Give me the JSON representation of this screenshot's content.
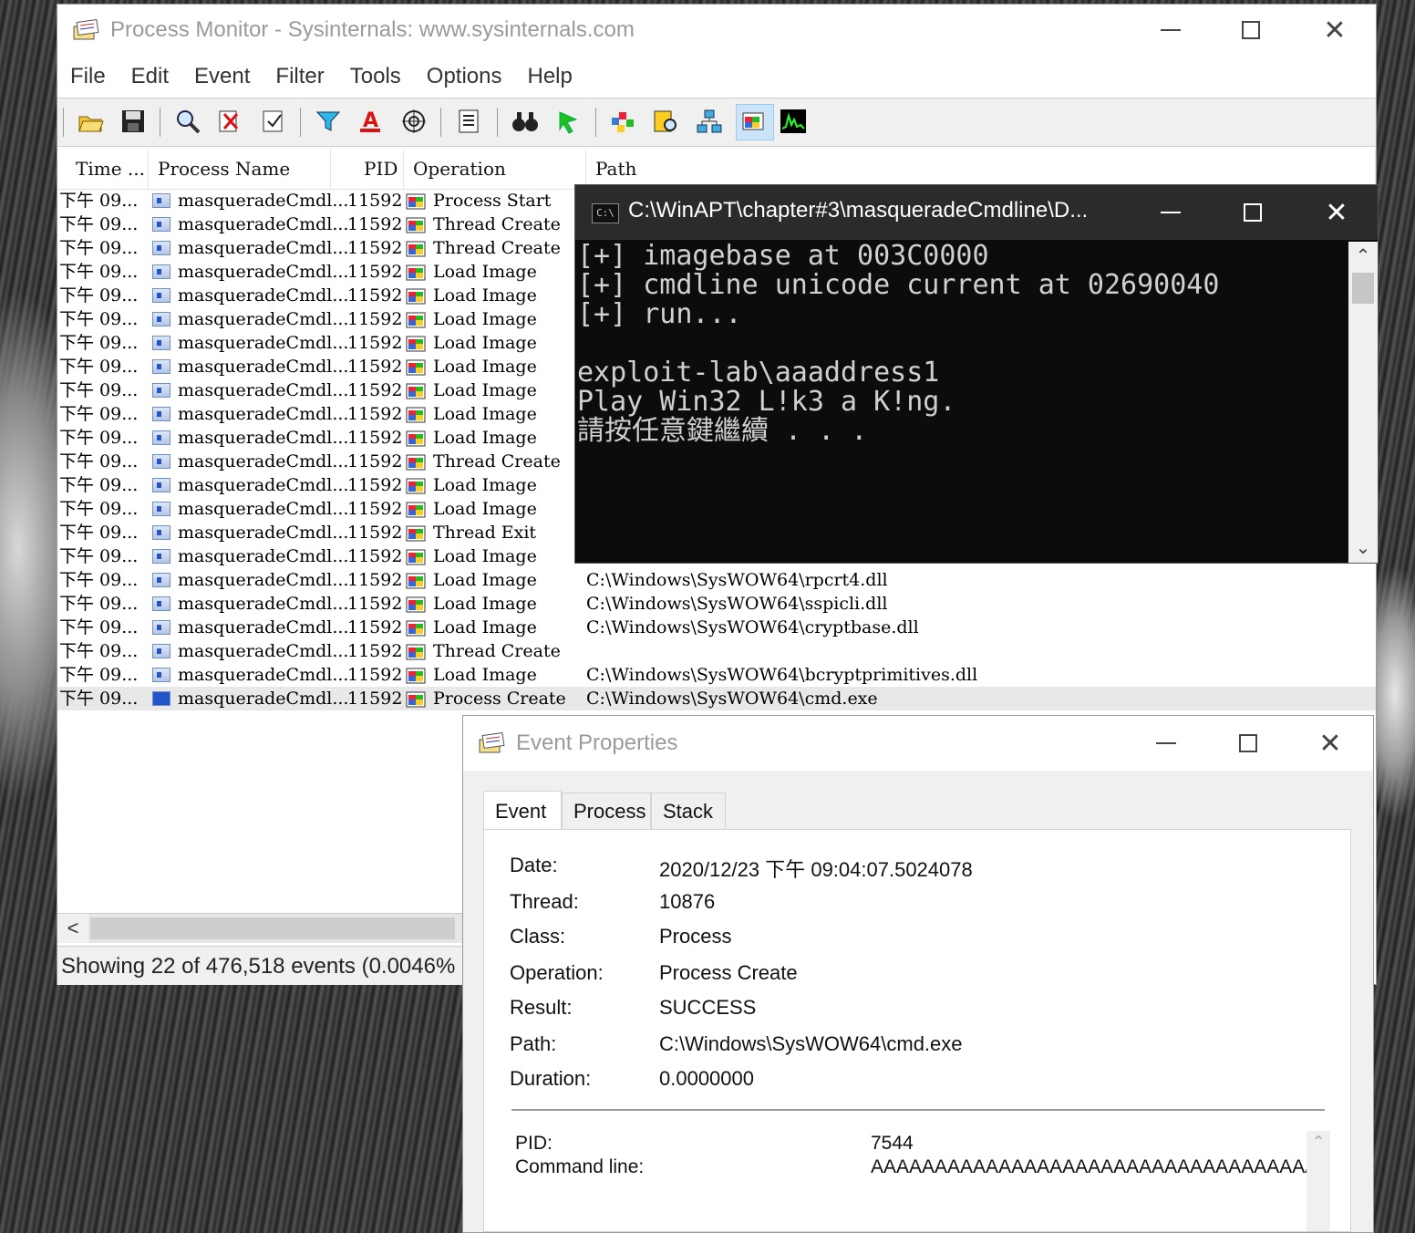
{
  "procmon": {
    "title": "Process Monitor - Sysinternals: www.sysinternals.com",
    "menu": [
      "File",
      "Edit",
      "Event",
      "Filter",
      "Tools",
      "Options",
      "Help"
    ],
    "columns": {
      "time": "Time ...",
      "process": "Process Name",
      "pid": "PID",
      "operation": "Operation",
      "path": "Path"
    },
    "rows": [
      {
        "time": "下午 09...",
        "process": "masqueradeCmdl...",
        "pid": "11592",
        "operation": "Process Start",
        "path": ""
      },
      {
        "time": "下午 09...",
        "process": "masqueradeCmdl...",
        "pid": "11592",
        "operation": "Thread Create",
        "path": ""
      },
      {
        "time": "下午 09...",
        "process": "masqueradeCmdl...",
        "pid": "11592",
        "operation": "Thread Create",
        "path": ""
      },
      {
        "time": "下午 09...",
        "process": "masqueradeCmdl...",
        "pid": "11592",
        "operation": "Load Image",
        "path": ""
      },
      {
        "time": "下午 09...",
        "process": "masqueradeCmdl...",
        "pid": "11592",
        "operation": "Load Image",
        "path": ""
      },
      {
        "time": "下午 09...",
        "process": "masqueradeCmdl...",
        "pid": "11592",
        "operation": "Load Image",
        "path": ""
      },
      {
        "time": "下午 09...",
        "process": "masqueradeCmdl...",
        "pid": "11592",
        "operation": "Load Image",
        "path": ""
      },
      {
        "time": "下午 09...",
        "process": "masqueradeCmdl...",
        "pid": "11592",
        "operation": "Load Image",
        "path": ""
      },
      {
        "time": "下午 09...",
        "process": "masqueradeCmdl...",
        "pid": "11592",
        "operation": "Load Image",
        "path": ""
      },
      {
        "time": "下午 09...",
        "process": "masqueradeCmdl...",
        "pid": "11592",
        "operation": "Load Image",
        "path": ""
      },
      {
        "time": "下午 09...",
        "process": "masqueradeCmdl...",
        "pid": "11592",
        "operation": "Load Image",
        "path": ""
      },
      {
        "time": "下午 09...",
        "process": "masqueradeCmdl...",
        "pid": "11592",
        "operation": "Thread Create",
        "path": ""
      },
      {
        "time": "下午 09...",
        "process": "masqueradeCmdl...",
        "pid": "11592",
        "operation": "Load Image",
        "path": ""
      },
      {
        "time": "下午 09...",
        "process": "masqueradeCmdl...",
        "pid": "11592",
        "operation": "Load Image",
        "path": ""
      },
      {
        "time": "下午 09...",
        "process": "masqueradeCmdl...",
        "pid": "11592",
        "operation": "Thread Exit",
        "path": ""
      },
      {
        "time": "下午 09...",
        "process": "masqueradeCmdl...",
        "pid": "11592",
        "operation": "Load Image",
        "path": ""
      },
      {
        "time": "下午 09...",
        "process": "masqueradeCmdl...",
        "pid": "11592",
        "operation": "Load Image",
        "path": "C:\\Windows\\SysWOW64\\rpcrt4.dll"
      },
      {
        "time": "下午 09...",
        "process": "masqueradeCmdl...",
        "pid": "11592",
        "operation": "Load Image",
        "path": "C:\\Windows\\SysWOW64\\sspicli.dll"
      },
      {
        "time": "下午 09...",
        "process": "masqueradeCmdl...",
        "pid": "11592",
        "operation": "Load Image",
        "path": "C:\\Windows\\SysWOW64\\cryptbase.dll"
      },
      {
        "time": "下午 09...",
        "process": "masqueradeCmdl...",
        "pid": "11592",
        "operation": "Thread Create",
        "path": ""
      },
      {
        "time": "下午 09...",
        "process": "masqueradeCmdl...",
        "pid": "11592",
        "operation": "Load Image",
        "path": "C:\\Windows\\SysWOW64\\bcryptprimitives.dll"
      },
      {
        "time": "下午 09...",
        "process": "masqueradeCmdl...",
        "pid": "11592",
        "operation": "Process Create",
        "path": "C:\\Windows\\SysWOW64\\cmd.exe"
      }
    ],
    "status": "Showing 22 of 476,518 events (0.0046%"
  },
  "console": {
    "icon_text": "C:\\",
    "title": "C:\\WinAPT\\chapter#3\\masqueradeCmdline\\D...",
    "lines": [
      "[+] imagebase at 003C0000",
      "[+] cmdline unicode current at 02690040",
      "[+] run...",
      "",
      "exploit-lab\\aaaddress1",
      "Play Win32 L!k3 a K!ng.",
      "請按任意鍵繼續 . . ."
    ]
  },
  "event_props": {
    "title": "Event Properties",
    "tabs": [
      "Event",
      "Process",
      "Stack"
    ],
    "labels": {
      "date": "Date:",
      "thread": "Thread:",
      "class": "Class:",
      "operation": "Operation:",
      "result": "Result:",
      "path": "Path:",
      "duration": "Duration:",
      "pid": "PID:",
      "cmdline": "Command line:"
    },
    "values": {
      "date": "2020/12/23 下午 09:04:07.5024078",
      "thread": "10876",
      "class": "Process",
      "operation": "Process Create",
      "result": "SUCCESS",
      "path": "C:\\Windows\\SysWOW64\\cmd.exe",
      "duration": "0.0000000",
      "pid": "7544",
      "cmdline": "AAAAAAAAAAAAAAAAAAAAAAAAAAAAAAAAAAA"
    }
  },
  "icons": {
    "toolbar": [
      "open-icon",
      "save-icon",
      "capture-icon",
      "autoscroll-icon",
      "clear-icon",
      "filter-icon",
      "highlight-icon",
      "include-process-icon",
      "properties-icon",
      "find-icon",
      "jump-icon",
      "registry-activity-icon",
      "file-activity-icon",
      "network-activity-icon",
      "process-activity-icon",
      "profiling-icon"
    ]
  },
  "colors": {
    "console_bg": "#0c0c0c",
    "console_fg": "#d0d0d0",
    "selected_row": "#e8e8e8"
  }
}
